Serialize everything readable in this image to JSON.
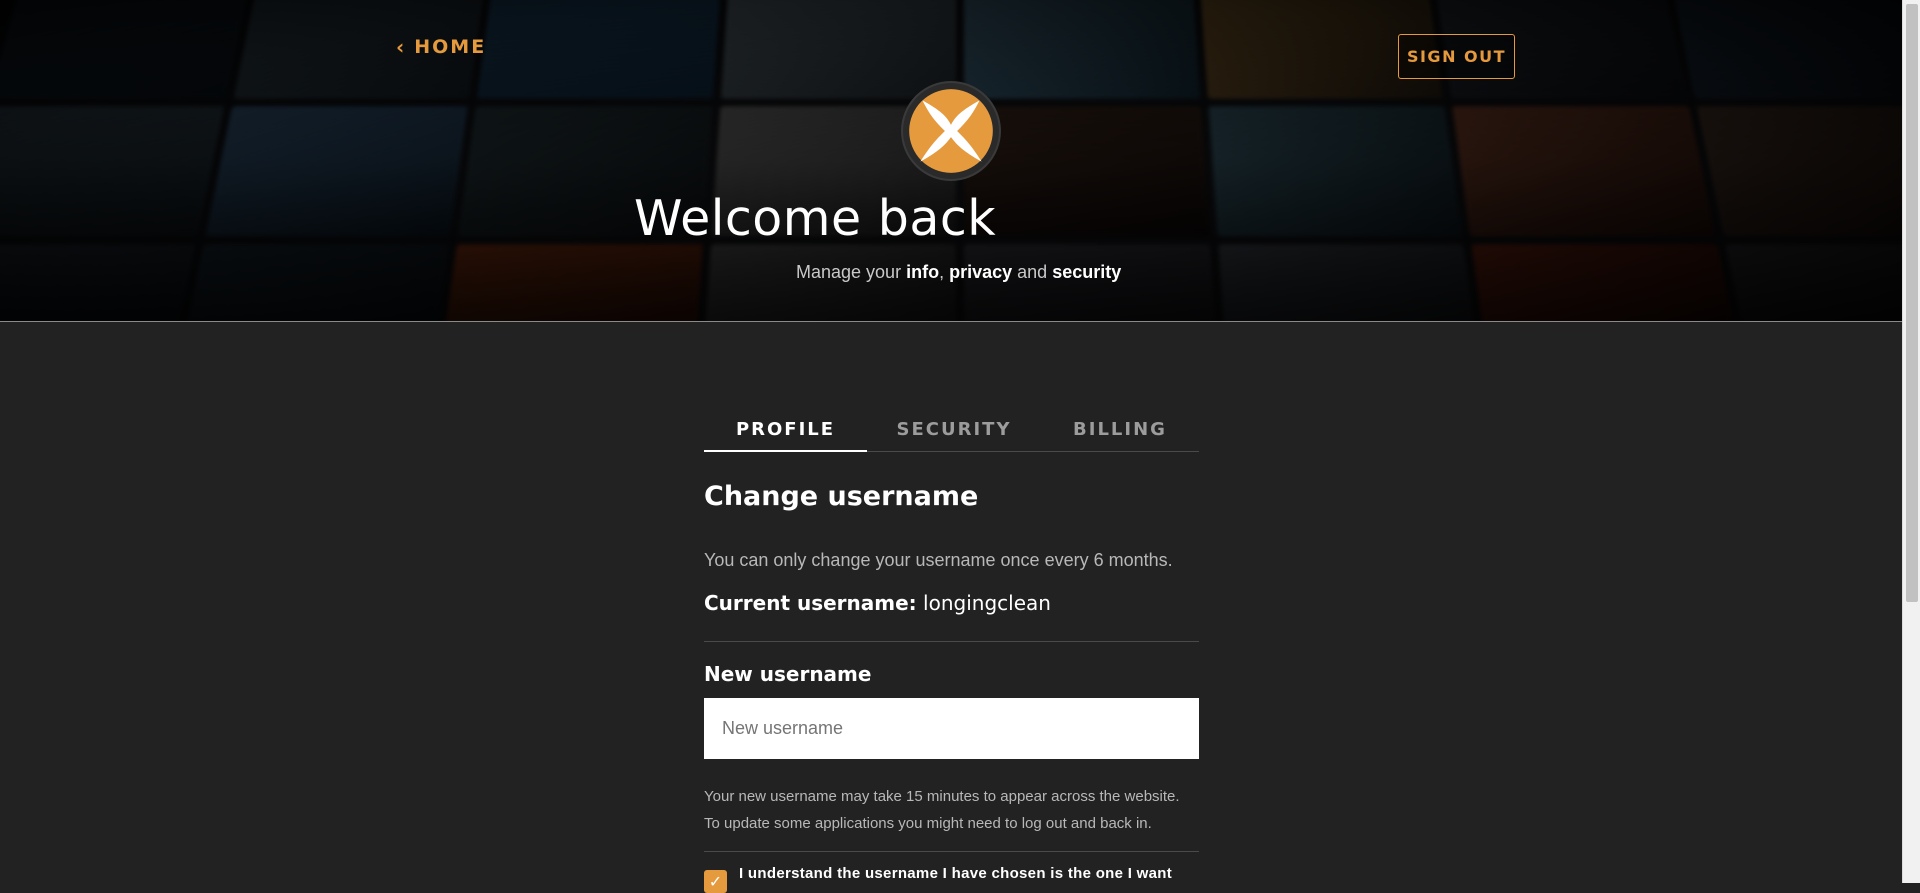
{
  "header": {
    "home_label": "HOME",
    "signout_label": "SIGN OUT",
    "welcome": "Welcome back",
    "subtitle": {
      "part1": "Manage your ",
      "info": "info",
      "comma": ", ",
      "privacy": "privacy",
      "and": " and ",
      "security": "security"
    }
  },
  "tabs": [
    {
      "label": "PROFILE",
      "active": true
    },
    {
      "label": "SECURITY",
      "active": false
    },
    {
      "label": "BILLING",
      "active": false
    }
  ],
  "profile": {
    "section_title": "Change username",
    "note": "You can only change your username once every 6 months.",
    "current_label": "Current username:",
    "current_value": "longingclean",
    "field_label": "New username",
    "input_placeholder": "New username",
    "input_value": "",
    "help_line1": "Your new username may take 15 minutes to appear across the website.",
    "help_line2": "To update some applications you might need to log out and back in.",
    "confirm_text": "I understand the username I have chosen is the one I want",
    "confirm_checked": true
  },
  "colors": {
    "accent": "#e59a3d",
    "background": "#222222",
    "text": "#ffffff",
    "muted": "#b8b8b8"
  },
  "icons": {
    "home": "chevron-left-icon",
    "logo": "brand-logo-icon",
    "checkbox": "checkmark-icon"
  }
}
